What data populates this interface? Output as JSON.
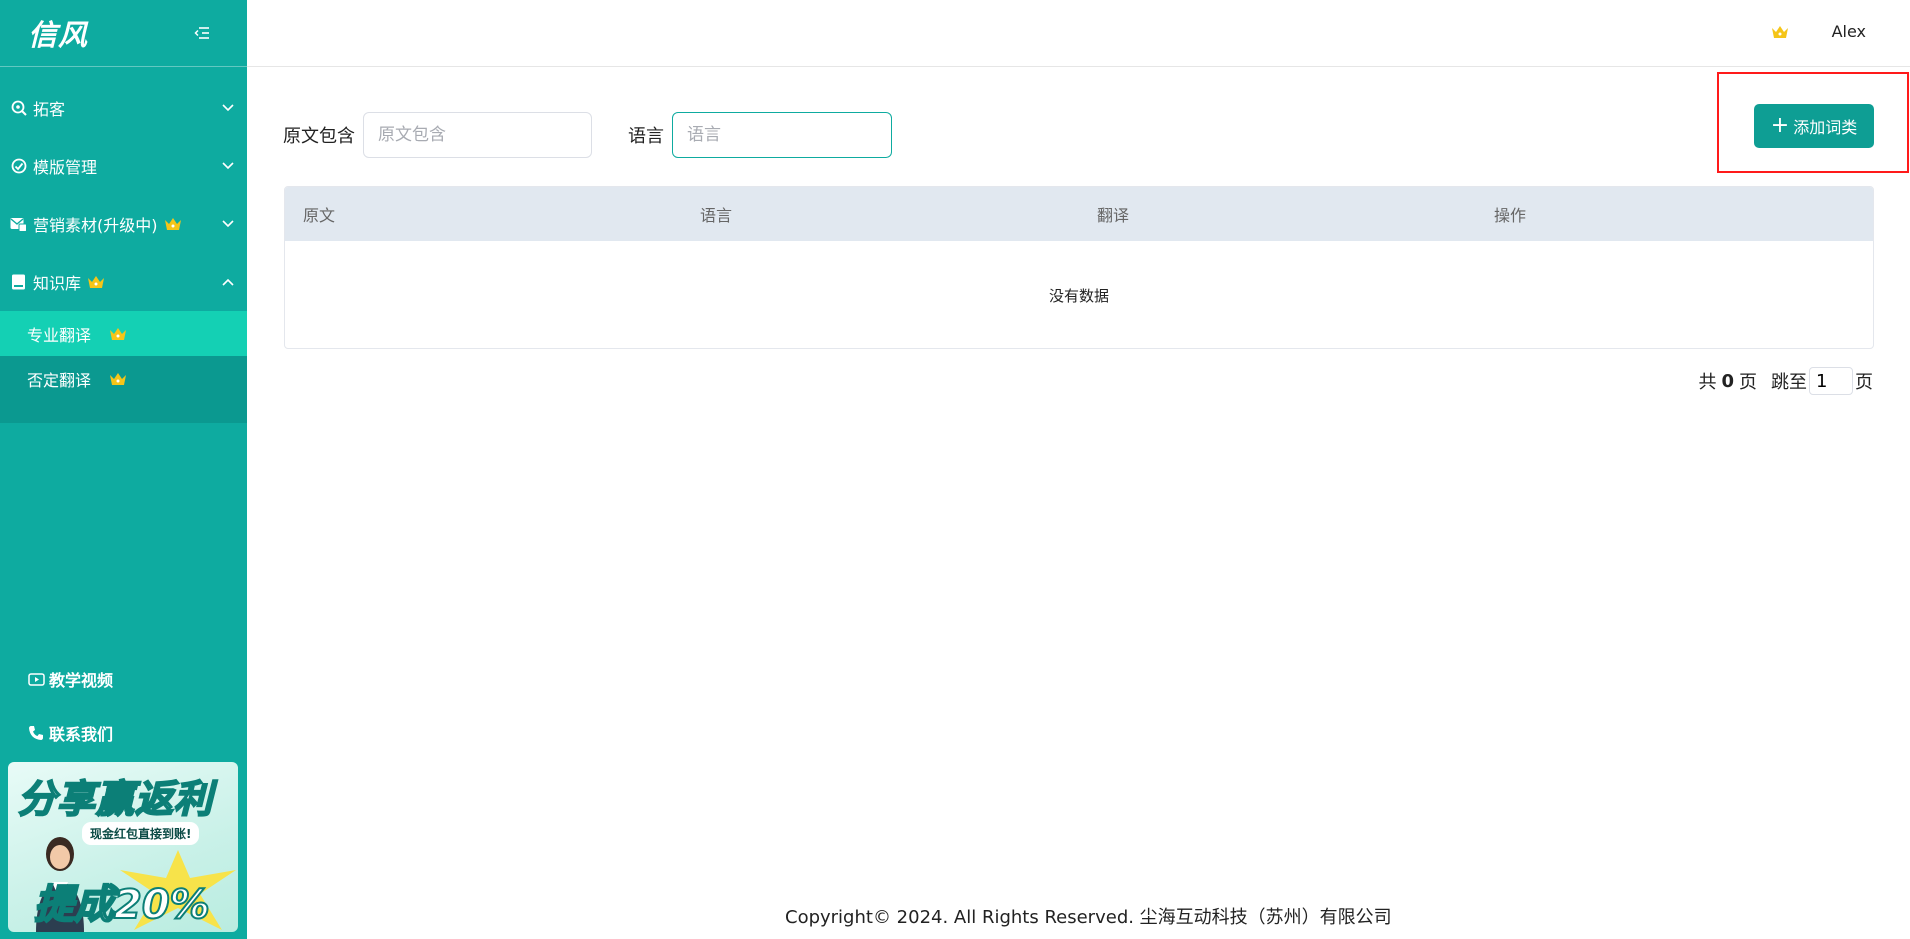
{
  "app": {
    "logo": "信风"
  },
  "colors": {
    "primary": "#0eaba0",
    "submenu_bg": "#0b9990",
    "active": "#14d0b4",
    "crown": "#f5c518",
    "highlight": "#ff1a1a"
  },
  "sidebar": {
    "collapse_icon": "menu-fold-icon",
    "items": [
      {
        "label": "拓客",
        "icon": "search-circle-icon",
        "crown": false,
        "expanded": false
      },
      {
        "label": "模版管理",
        "icon": "check-circle-icon",
        "crown": false,
        "expanded": false
      },
      {
        "label": "营销素材(升级中)",
        "icon": "mail-image-icon",
        "crown": true,
        "expanded": false
      },
      {
        "label": "知识库",
        "icon": "book-icon",
        "crown": true,
        "expanded": true,
        "children": [
          {
            "label": "专业翻译",
            "crown": true,
            "active": true
          },
          {
            "label": "否定翻译",
            "crown": true,
            "active": false
          }
        ]
      }
    ],
    "bottom_links": [
      {
        "label": "教学视频",
        "icon": "video-icon"
      },
      {
        "label": "联系我们",
        "icon": "phone-icon"
      }
    ],
    "promo": {
      "title": "分享赢返利",
      "subtitle": "现金红包直接到账!",
      "percent_label": "提成20%"
    }
  },
  "topbar": {
    "username": "Alex",
    "crown_icon": "crown-icon"
  },
  "filters": {
    "source_label": "原文包含",
    "source_placeholder": "原文包含",
    "source_value": "",
    "lang_label": "语言",
    "lang_placeholder": "语言",
    "lang_value": ""
  },
  "actions": {
    "add_label": "添加词类"
  },
  "table": {
    "columns": [
      "原文",
      "语言",
      "翻译",
      "操作"
    ],
    "rows": [],
    "empty_text": "没有数据"
  },
  "pagination": {
    "total_prefix": "共",
    "total_pages": "0",
    "total_suffix": "页",
    "jump_prefix": "跳至",
    "jump_value": "1",
    "jump_suffix": "页"
  },
  "footer": {
    "copyright": "Copyright© 2024. All Rights Reserved. 尘海互动科技（苏州）有限公司"
  }
}
